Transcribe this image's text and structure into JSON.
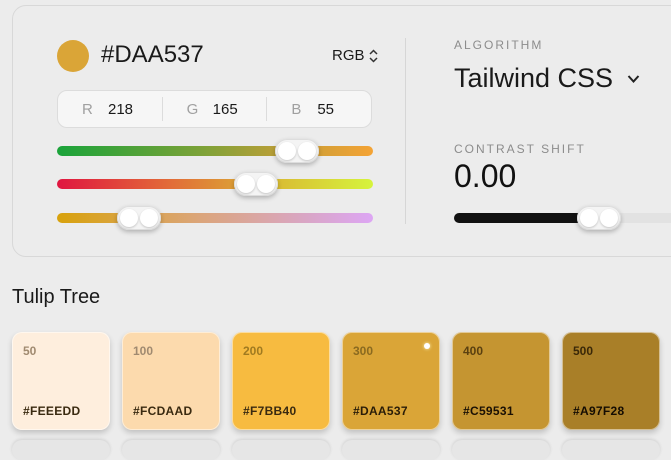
{
  "picker": {
    "hex": "#DAA537",
    "swatch_color": "#DAA537",
    "mode": "RGB",
    "channels": [
      {
        "label": "R",
        "value": "218"
      },
      {
        "label": "G",
        "value": "165"
      },
      {
        "label": "B",
        "value": "55"
      }
    ],
    "slider_levels": [
      0.76,
      0.63,
      0.26
    ]
  },
  "settings": {
    "algorithm_label": "ALGORITHM",
    "algorithm_value": "Tailwind CSS",
    "contrast_label": "CONTRAST SHIFT",
    "contrast_value": "0.00",
    "contrast_level": 0.5
  },
  "palette": {
    "name": "Tulip Tree",
    "swatches": [
      {
        "step": "50",
        "hex": "#FEEEDD",
        "text_color": "#a08a70",
        "hex_color": "#3a2a10"
      },
      {
        "step": "100",
        "hex": "#FCDAAD",
        "text_color": "#a08a70",
        "hex_color": "#3a2a10"
      },
      {
        "step": "200",
        "hex": "#F7BB40",
        "text_color": "#a07a20",
        "hex_color": "#3a2a10"
      },
      {
        "step": "300",
        "hex": "#DAA537",
        "text_color": "#8a6a20",
        "hex_color": "#2a1d08",
        "selected": true
      },
      {
        "step": "400",
        "hex": "#C59531",
        "text_color": "#5a4010",
        "hex_color": "#1a1004"
      },
      {
        "step": "500",
        "hex": "#A97F28",
        "text_color": "#3a2808",
        "hex_color": "#140c02"
      }
    ]
  }
}
